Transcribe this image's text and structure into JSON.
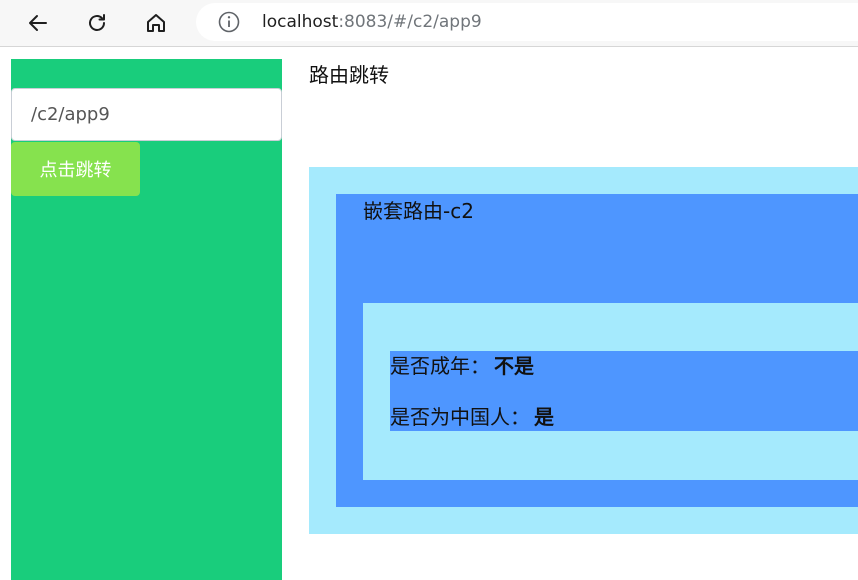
{
  "browser": {
    "url_host": "localhost",
    "url_rest": ":8083/#/c2/app9"
  },
  "sidebar": {
    "path_input_value": "/c2/app9",
    "jump_button_label": "点击跳转"
  },
  "main": {
    "title": "路由跳转",
    "nested_title": "嵌套路由-c2",
    "adult_label": "是否成年：",
    "adult_value": "不是",
    "chinese_label": "是否为中国人：",
    "chinese_value": "是"
  },
  "colors": {
    "sidebar_bg": "#19cd7c",
    "button_bg": "#86e24e",
    "light_blue": "#a5eafd",
    "blue": "#4e96ff"
  },
  "icons": [
    "back-arrow-icon",
    "reload-icon",
    "home-icon",
    "info-icon"
  ]
}
